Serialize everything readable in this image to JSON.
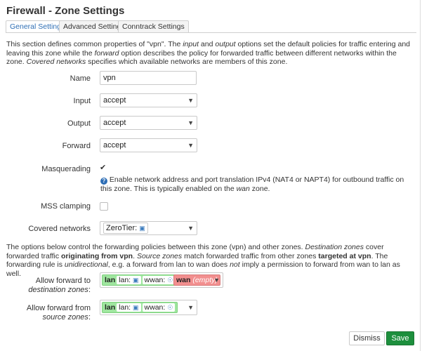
{
  "title": "Firewall - Zone Settings",
  "tabs": [
    {
      "label": "General Settings",
      "active": true
    },
    {
      "label": "Advanced Settings",
      "active": false
    },
    {
      "label": "Conntrack Settings",
      "active": false
    }
  ],
  "intro": {
    "t1": "This section defines common properties of \"vpn\". The ",
    "input_word": "input",
    "t2": " and ",
    "output_word": "output",
    "t3": " options set the default policies for traffic entering and leaving this zone while the ",
    "forward_word": "forward",
    "t4": " option describes the policy for forwarded traffic between different networks within the zone. ",
    "covered_word": "Covered networks",
    "t5": " specifies which available networks are members of this zone."
  },
  "form": {
    "name_label": "Name",
    "name_value": "vpn",
    "input_label": "Input",
    "input_value": "accept",
    "output_label": "Output",
    "output_value": "accept",
    "forward_label": "Forward",
    "forward_value": "accept",
    "masq_label": "Masquerading",
    "masq_checked": true,
    "masq_help_1": "Enable network address and port translation IPv4 (NAT4 or NAPT4) for outbound traffic on this zone. This is typically enabled on the ",
    "masq_help_wan": "wan",
    "masq_help_2": " zone.",
    "mss_label": "MSS clamping",
    "mss_checked": false,
    "covered_label": "Covered networks",
    "covered_value": "ZeroTier:"
  },
  "forwarding": {
    "d1": "The options below control the forwarding policies between this zone (vpn) and other zones. ",
    "d_dest": "Destination zones",
    "d2": " cover forwarded traffic ",
    "d_orig": "originating from vpn",
    "d3": ". ",
    "d_src": "Source zones",
    "d4": " match forwarded traffic from other zones ",
    "d_targ": "targeted at vpn",
    "d5": ". The forwarding rule is ",
    "d_uni": "unidirectional",
    "d6": ", e.g. a forward from lan to wan does ",
    "d_not": "not",
    "d7": " imply a permission to forward from wan to lan as well.",
    "dest_label_1": "Allow forward to ",
    "dest_label_em": "destination zones",
    "dest_label_2": ":",
    "src_label_1": "Allow forward from ",
    "src_label_em": "source zones",
    "src_label_2": ":",
    "zone_lan": "lan",
    "zone_lan_net": "lan:",
    "zone_wwan_net": "wwan:",
    "zone_wan": "wan",
    "zone_wan_empty": "(empty)"
  },
  "buttons": {
    "dismiss": "Dismiss",
    "save": "Save"
  },
  "colors": {
    "accent": "#2f6fb5",
    "save": "#1d8f3d",
    "zone_green": "#9fe69f",
    "zone_red": "#f28f8f"
  }
}
